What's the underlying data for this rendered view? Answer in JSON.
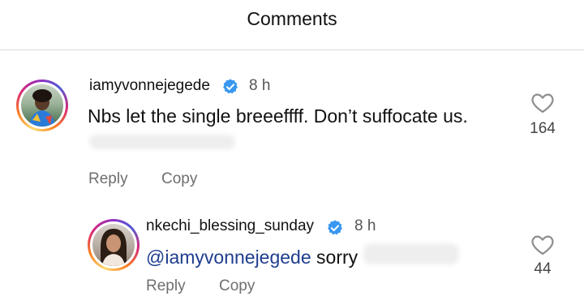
{
  "header": {
    "title": "Comments"
  },
  "comments": [
    {
      "username": "iamyvonnejegede",
      "time": "8 h",
      "text": "Nbs let the single breeeffff. Don’t suffocate us.",
      "likes": "164",
      "reply_label": "Reply",
      "copy_label": "Copy"
    },
    {
      "username": "nkechi_blessing_sunday",
      "time": "8 h",
      "mention": "@iamyvonnejegede",
      "text": " sorry",
      "likes": "44",
      "reply_label": "Reply",
      "copy_label": "Copy"
    }
  ],
  "colors": {
    "verified_badge": "#3897f0",
    "mention": "#1e3d8f",
    "divider": "#dbdbdb"
  },
  "icons": {
    "verified": "verified-badge-icon",
    "like": "heart-outline-icon"
  }
}
